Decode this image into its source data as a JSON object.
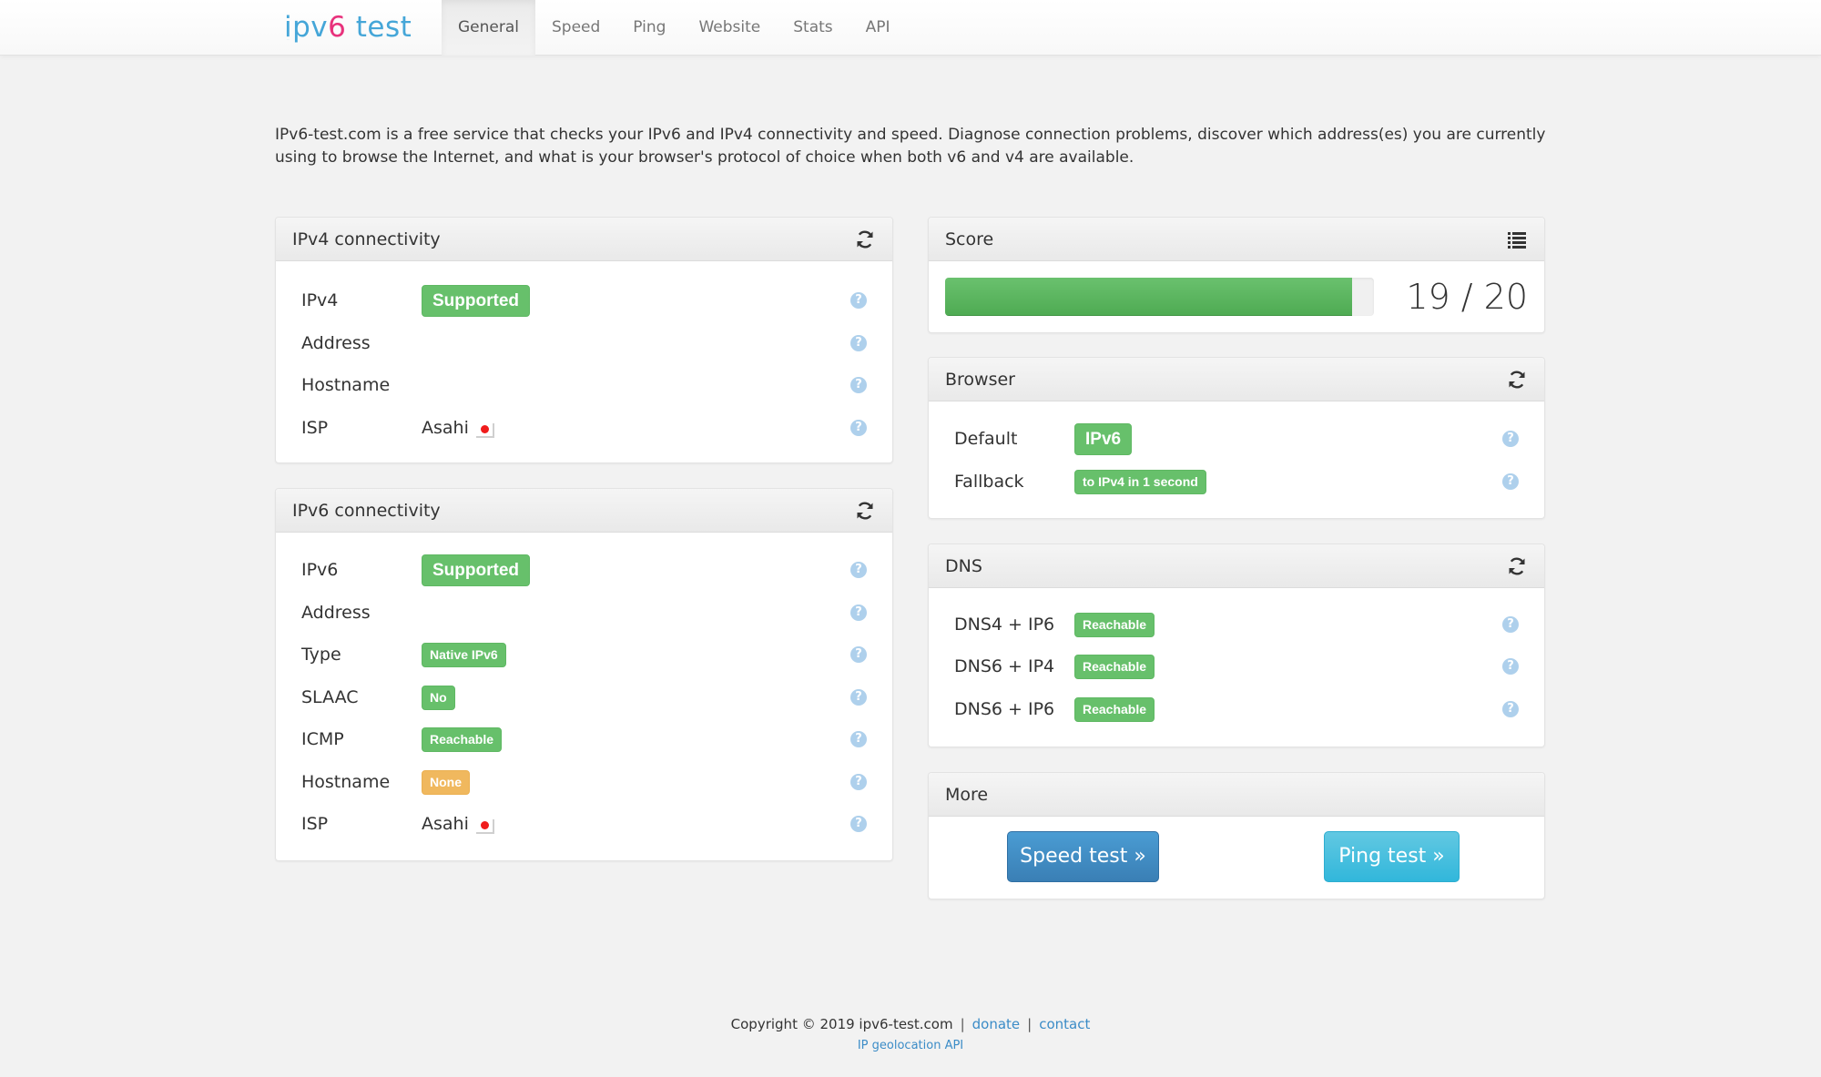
{
  "navbar": {
    "brand": {
      "part1": "ipv",
      "part2": "6",
      "part3": " test"
    },
    "items": [
      {
        "label": "General",
        "active": true
      },
      {
        "label": "Speed",
        "active": false
      },
      {
        "label": "Ping",
        "active": false
      },
      {
        "label": "Website",
        "active": false
      },
      {
        "label": "Stats",
        "active": false
      },
      {
        "label": "API",
        "active": false
      }
    ]
  },
  "intro": "IPv6-test.com is a free service that checks your IPv6 and IPv4 connectivity and speed. Diagnose connection problems, discover which address(es) you are currently using to browse the Internet, and what is your browser's protocol of choice when both v6 and v4 are available.",
  "ipv4_panel": {
    "title": "IPv4 connectivity",
    "tool_icon": "refresh-icon",
    "rows": [
      {
        "label": "IPv4",
        "value": "Supported",
        "kind": "badge-lg"
      },
      {
        "label": "Address",
        "value": "",
        "kind": "text"
      },
      {
        "label": "Hostname",
        "value": "",
        "kind": "text"
      },
      {
        "label": "ISP",
        "value": "Asahi",
        "kind": "text",
        "flag": "japan-flag-icon"
      }
    ]
  },
  "ipv6_panel": {
    "title": "IPv6 connectivity",
    "tool_icon": "refresh-icon",
    "rows": [
      {
        "label": "IPv6",
        "value": "Supported",
        "kind": "badge-lg"
      },
      {
        "label": "Address",
        "value": "",
        "kind": "text"
      },
      {
        "label": "Type",
        "value": "Native IPv6",
        "kind": "badge-sm"
      },
      {
        "label": "SLAAC",
        "value": "No",
        "kind": "badge-sm"
      },
      {
        "label": "ICMP",
        "value": "Reachable",
        "kind": "badge-sm"
      },
      {
        "label": "Hostname",
        "value": "None",
        "kind": "badge-sm-warn"
      },
      {
        "label": "ISP",
        "value": "Asahi",
        "kind": "text",
        "flag": "japan-flag-icon"
      }
    ]
  },
  "score_panel": {
    "title": "Score",
    "tool_icon": "list-icon",
    "score": 19,
    "max": 20,
    "score_text": "19 / 20",
    "progress_fraction": 0.95
  },
  "browser_panel": {
    "title": "Browser",
    "tool_icon": "refresh-icon",
    "rows": [
      {
        "label": "Default",
        "value": "IPv6",
        "kind": "badge-lg"
      },
      {
        "label": "Fallback",
        "value": "to IPv4 in 1 second",
        "kind": "badge-sm"
      }
    ]
  },
  "dns_panel": {
    "title": "DNS",
    "tool_icon": "refresh-icon",
    "rows": [
      {
        "label": "DNS4 + IP6",
        "value": "Reachable",
        "kind": "badge-sm"
      },
      {
        "label": "DNS6 + IP4",
        "value": "Reachable",
        "kind": "badge-sm"
      },
      {
        "label": "DNS6 + IP6",
        "value": "Reachable",
        "kind": "badge-sm"
      }
    ]
  },
  "more_panel": {
    "title": "More",
    "speed_button": "Speed test »",
    "ping_button": "Ping test »"
  },
  "help_glyph": "?",
  "footer": {
    "copyright": "Copyright © 2019 ipv6-test.com",
    "separator": "|",
    "donate": "donate",
    "contact": "contact",
    "geo_api": "IP geolocation API"
  },
  "colors": {
    "success": "#67c06b",
    "warning": "#f0b85e",
    "primary": "#3a7fb5",
    "info": "#31b7db",
    "brand_blue": "#45a6d8",
    "brand_pink": "#e8327c",
    "link": "#3b8cc7"
  }
}
